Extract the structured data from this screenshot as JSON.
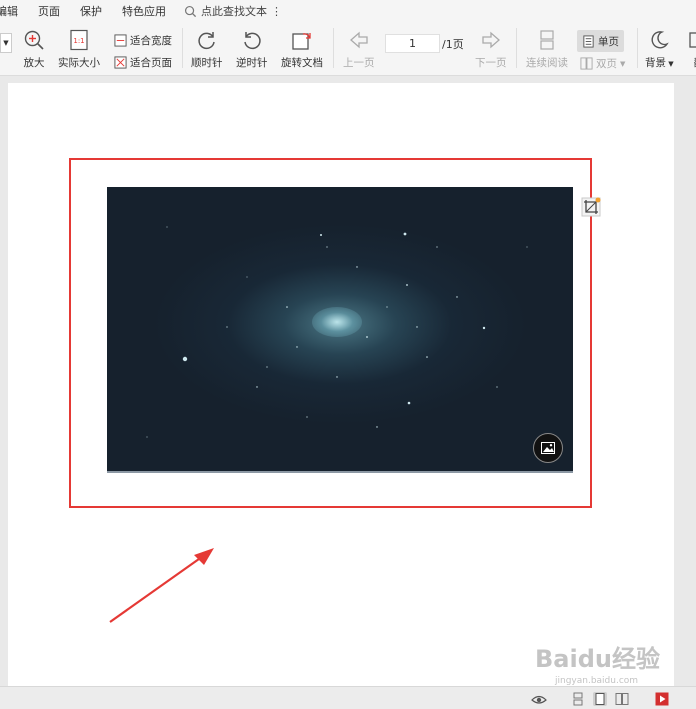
{
  "menu": {
    "items": [
      "编辑",
      "页面",
      "保护",
      "特色应用"
    ],
    "search_label": "点此查找文本"
  },
  "toolbar": {
    "zoom_in": "放大",
    "actual_size": "实际大小",
    "actual_size_glyph": "1:1",
    "fit_width": "适合宽度",
    "fit_page": "适合页面",
    "clockwise": "顺时针",
    "counterclockwise": "逆时针",
    "rotate_doc": "旋转文档",
    "prev_page": "上一页",
    "page_current": "1",
    "page_total": "/1页",
    "next_page": "下一页",
    "continuous": "连续阅读",
    "single_page": "单页",
    "double_page": "双页",
    "background": "背景",
    "cut_label": "翻"
  },
  "watermark": {
    "brand": "Baidu经验",
    "url": "jingyan.baidu.com"
  },
  "colors": {
    "annotation_red": "#e53935",
    "toolbar_bg": "#f5f5f5",
    "canvas_bg": "#e9e9e9",
    "image_bg": "#16212d"
  },
  "icons": {
    "zoom_in": "zoom-in-icon",
    "rotate_cw": "rotate-clockwise-icon",
    "rotate_ccw": "rotate-counterclockwise-icon",
    "image_badge": "image-icon",
    "crop": "crop-icon",
    "eye": "eye-icon",
    "play": "play-icon"
  }
}
